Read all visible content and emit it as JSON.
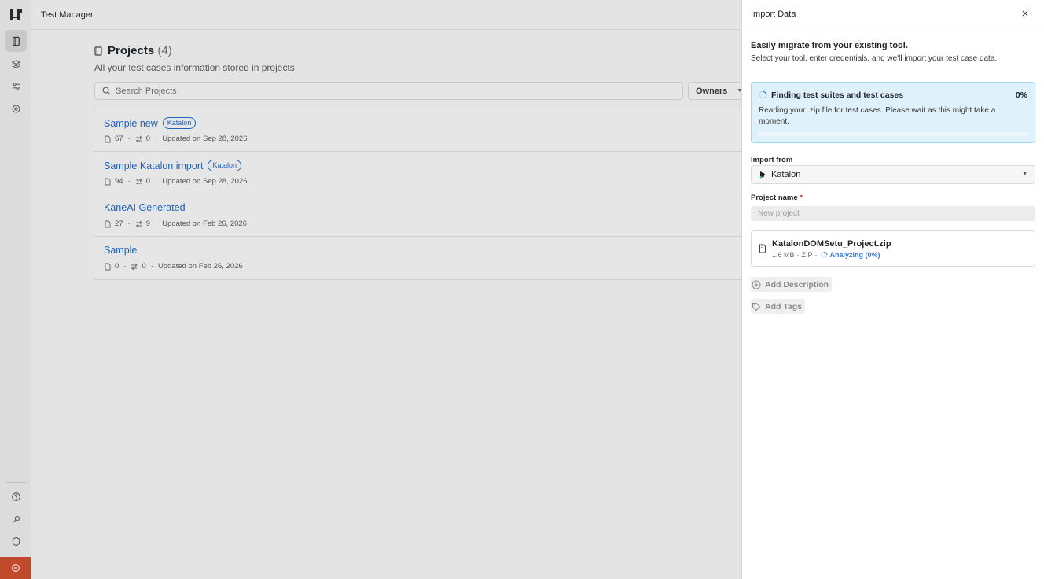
{
  "app": {
    "title": "Test Manager"
  },
  "rail": {
    "top_icons": [
      "projects-icon",
      "layers-icon",
      "sliders-icon",
      "settings-icon"
    ],
    "bottom_icons": [
      "help-icon",
      "key-icon",
      "shield-icon",
      "power-icon"
    ],
    "accent": "#c14a2c"
  },
  "projects": {
    "title": "Projects",
    "count": "(4)",
    "subtitle": "All your test cases information stored in projects",
    "search_placeholder": "Search Projects",
    "owners_label": "Owners",
    "items": [
      {
        "name": "Sample new",
        "badge": "Katalon",
        "cases": "67",
        "runs": "0",
        "updated": "Updated on Sep 28, 2026"
      },
      {
        "name": "Sample Katalon import",
        "badge": "Katalon",
        "cases": "94",
        "runs": "0",
        "updated": "Updated on Sep 28, 2026"
      },
      {
        "name": "KaneAI Generated",
        "badge": "",
        "cases": "27",
        "runs": "9",
        "updated": "Updated on Feb 26, 2026"
      },
      {
        "name": "Sample",
        "badge": "",
        "cases": "0",
        "runs": "0",
        "updated": "Updated on Feb 26, 2026"
      }
    ]
  },
  "import": {
    "title": "Import Data",
    "intro_bold": "Easily migrate from your existing tool.",
    "intro_text": "Select your tool, enter credentials, and we'll import your test case data.",
    "status": {
      "title": "Finding test suites and test cases",
      "percent": "0%",
      "progress": 0,
      "text": "Reading your .zip file for test cases. Please wait as this might take a moment."
    },
    "import_from_label": "Import from",
    "import_from_value": "Katalon",
    "project_name_label": "Project name",
    "required_mark": "*",
    "project_name_placeholder": "New project",
    "file": {
      "name": "KatalonDOMSetu_Project.zip",
      "size": "1.6 MB",
      "type": "ZIP",
      "status": "Analyzing (0%)"
    },
    "add_description": "Add Description",
    "add_tags": "Add Tags"
  }
}
